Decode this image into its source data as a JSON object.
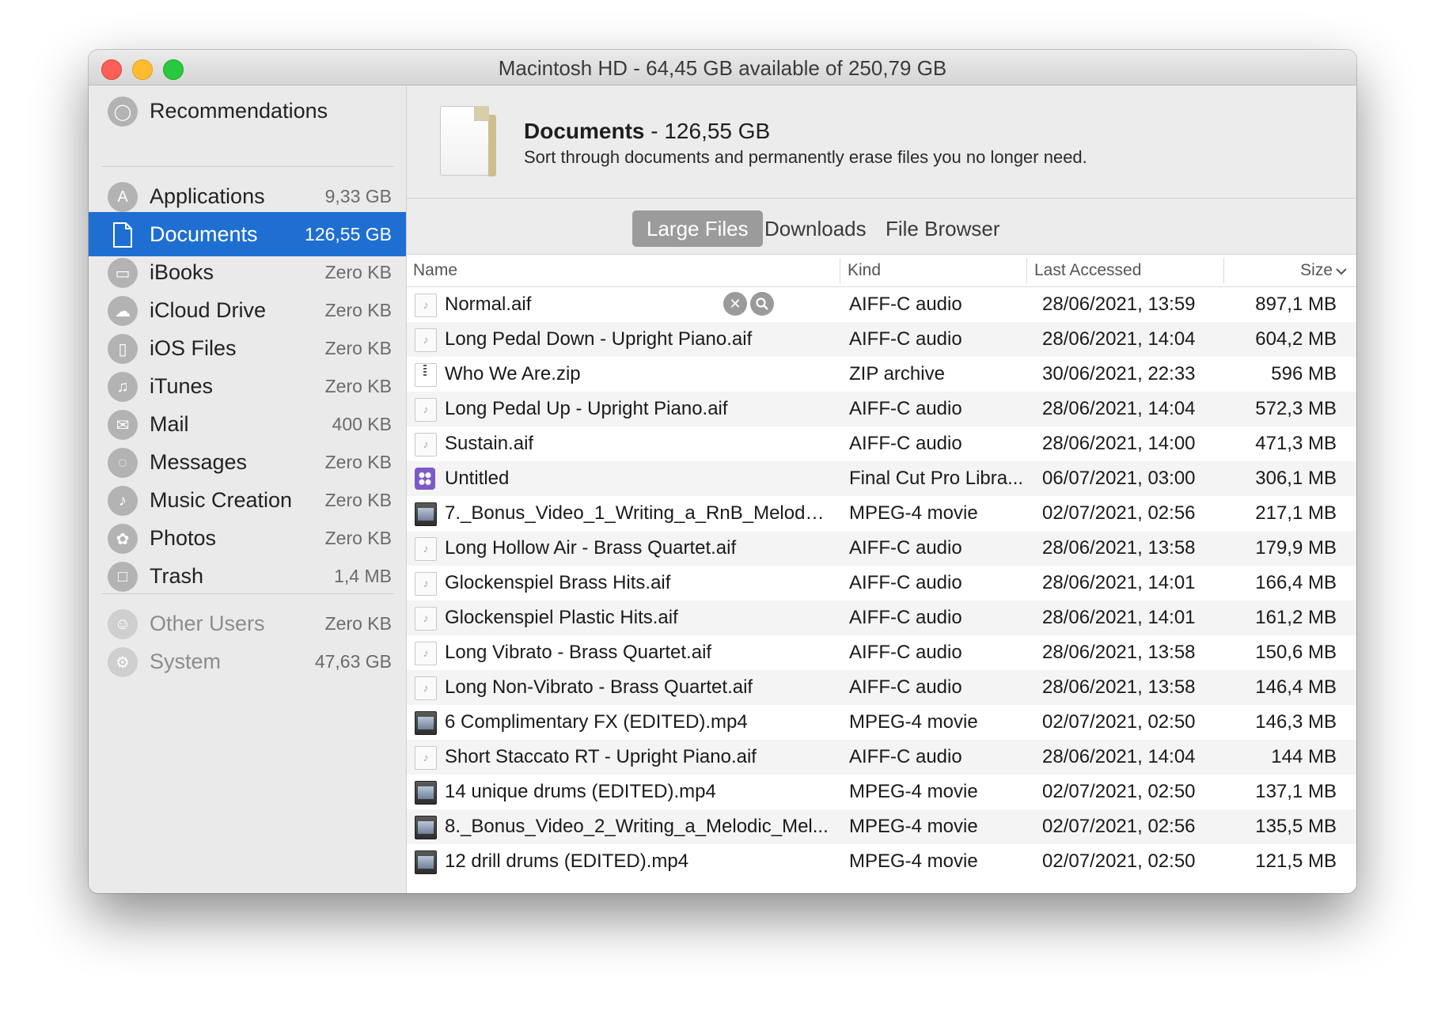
{
  "window": {
    "title": "Macintosh HD - 64,45 GB available of 250,79 GB"
  },
  "sidebar": {
    "top": {
      "label": "Recommendations",
      "icon": "lightbulb-icon"
    },
    "items": [
      {
        "label": "Applications",
        "size": "9,33 GB",
        "icon": "app-store-icon"
      },
      {
        "label": "Documents",
        "size": "126,55 GB",
        "icon": "document-icon",
        "selected": true
      },
      {
        "label": "iBooks",
        "size": "Zero KB",
        "icon": "book-icon"
      },
      {
        "label": "iCloud Drive",
        "size": "Zero KB",
        "icon": "cloud-icon"
      },
      {
        "label": "iOS Files",
        "size": "Zero KB",
        "icon": "iphone-icon"
      },
      {
        "label": "iTunes",
        "size": "Zero KB",
        "icon": "music-note-icon"
      },
      {
        "label": "Mail",
        "size": "400 KB",
        "icon": "mail-stamp-icon"
      },
      {
        "label": "Messages",
        "size": "Zero KB",
        "icon": "messages-icon"
      },
      {
        "label": "Music Creation",
        "size": "Zero KB",
        "icon": "guitar-icon"
      },
      {
        "label": "Photos",
        "size": "Zero KB",
        "icon": "photos-flower-icon"
      },
      {
        "label": "Trash",
        "size": "1,4 MB",
        "icon": "trash-icon"
      }
    ],
    "other": [
      {
        "label": "Other Users",
        "size": "Zero KB",
        "icon": "users-icon"
      },
      {
        "label": "System",
        "size": "47,63 GB",
        "icon": "gear-icon"
      }
    ]
  },
  "header": {
    "title": "Documents",
    "size": " - 126,55 GB",
    "subtitle": "Sort through documents and permanently erase files you no longer need."
  },
  "tabs": [
    {
      "label": "Large Files",
      "active": true
    },
    {
      "label": "Downloads"
    },
    {
      "label": "File Browser"
    }
  ],
  "table": {
    "columns": {
      "name": "Name",
      "kind": "Kind",
      "last_accessed": "Last Accessed",
      "size": "Size"
    },
    "sort": {
      "column": "size",
      "direction": "descending"
    },
    "rows": [
      {
        "icon": "audio",
        "name": "Normal.aif",
        "kind": "AIFF-C audio",
        "date": "28/06/2021, 13:59",
        "size": "897,1 MB",
        "hovered": true
      },
      {
        "icon": "audio",
        "name": "Long Pedal Down - Upright Piano.aif",
        "kind": "AIFF-C audio",
        "date": "28/06/2021, 14:04",
        "size": "604,2 MB"
      },
      {
        "icon": "zip",
        "name": "Who We Are.zip",
        "kind": "ZIP archive",
        "date": "30/06/2021, 22:33",
        "size": "596 MB"
      },
      {
        "icon": "audio",
        "name": "Long Pedal Up - Upright Piano.aif",
        "kind": "AIFF-C audio",
        "date": "28/06/2021, 14:04",
        "size": "572,3 MB"
      },
      {
        "icon": "audio",
        "name": "Sustain.aif",
        "kind": "AIFF-C audio",
        "date": "28/06/2021, 14:00",
        "size": "471,3 MB"
      },
      {
        "icon": "fcp",
        "name": "Untitled",
        "kind": "Final Cut Pro Libra...",
        "date": "06/07/2021, 03:00",
        "size": "306,1 MB"
      },
      {
        "icon": "movie",
        "name": "7._Bonus_Video_1_Writing_a_RnB_Melody_...",
        "kind": "MPEG-4 movie",
        "date": "02/07/2021, 02:56",
        "size": "217,1 MB"
      },
      {
        "icon": "audio",
        "name": "Long Hollow Air - Brass Quartet.aif",
        "kind": "AIFF-C audio",
        "date": "28/06/2021, 13:58",
        "size": "179,9 MB"
      },
      {
        "icon": "audio",
        "name": "Glockenspiel Brass Hits.aif",
        "kind": "AIFF-C audio",
        "date": "28/06/2021, 14:01",
        "size": "166,4 MB"
      },
      {
        "icon": "audio",
        "name": "Glockenspiel Plastic Hits.aif",
        "kind": "AIFF-C audio",
        "date": "28/06/2021, 14:01",
        "size": "161,2 MB"
      },
      {
        "icon": "audio",
        "name": "Long Vibrato - Brass Quartet.aif",
        "kind": "AIFF-C audio",
        "date": "28/06/2021, 13:58",
        "size": "150,6 MB"
      },
      {
        "icon": "audio",
        "name": "Long Non-Vibrato - Brass Quartet.aif",
        "kind": "AIFF-C audio",
        "date": "28/06/2021, 13:58",
        "size": "146,4 MB"
      },
      {
        "icon": "movie",
        "name": "6 Complimentary FX (EDITED).mp4",
        "kind": "MPEG-4 movie",
        "date": "02/07/2021, 02:50",
        "size": "146,3 MB"
      },
      {
        "icon": "audio",
        "name": "Short Staccato RT - Upright Piano.aif",
        "kind": "AIFF-C audio",
        "date": "28/06/2021, 14:04",
        "size": "144 MB"
      },
      {
        "icon": "movie",
        "name": "14 unique drums (EDITED).mp4",
        "kind": "MPEG-4 movie",
        "date": "02/07/2021, 02:50",
        "size": "137,1 MB"
      },
      {
        "icon": "movie",
        "name": "8._Bonus_Video_2_Writing_a_Melodic_Mel...",
        "kind": "MPEG-4 movie",
        "date": "02/07/2021, 02:56",
        "size": "135,5 MB"
      },
      {
        "icon": "movie",
        "name": "12 drill drums (EDITED).mp4",
        "kind": "MPEG-4 movie",
        "date": "02/07/2021, 02:50",
        "size": "121,5 MB"
      }
    ]
  },
  "colors": {
    "selection": "#1f6fd2",
    "tab_active": "#9b9b9b",
    "close": "#fe5f57",
    "minimize": "#febc2e",
    "zoom": "#28c840"
  }
}
